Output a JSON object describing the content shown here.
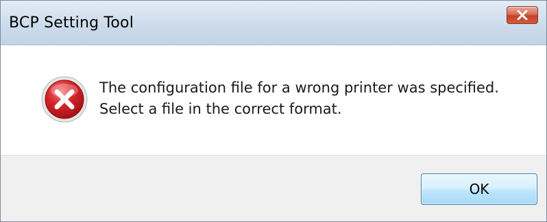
{
  "window": {
    "title": "BCP Setting Tool",
    "close_icon": "close-icon"
  },
  "message": {
    "icon": "error-icon",
    "line1": "The configuration file for a wrong printer was specified.",
    "line2": "Select a file in the correct format."
  },
  "buttons": {
    "ok_label": "OK"
  },
  "colors": {
    "close_button": "#c7432b",
    "error_icon": "#c9181f",
    "ok_button_border": "#3c7fb1",
    "footer_bg": "#f0f0f0"
  }
}
